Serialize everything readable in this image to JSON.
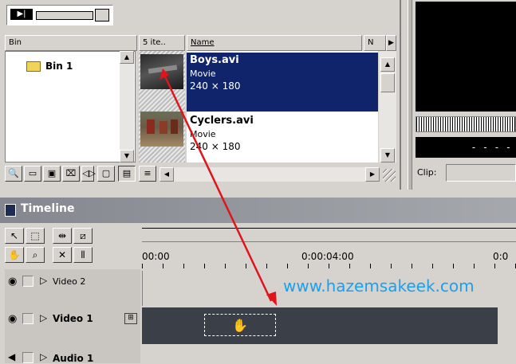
{
  "project": {
    "bin_header": "Bin",
    "count_header": "5 ite..",
    "name_header": "Name",
    "n_header": "N",
    "bin_item": "Bin 1",
    "clips": [
      {
        "name": "Boys.avi",
        "type": "Movie",
        "size": "240 × 180",
        "selected": true
      },
      {
        "name": "Cyclers.avi",
        "type": "Movie",
        "size": "240 × 180",
        "selected": false
      }
    ]
  },
  "monitor": {
    "timecode": "- - - -",
    "clip_label": "Clip:"
  },
  "timeline": {
    "title": "Timeline",
    "ruler": [
      "00:00",
      "0:00:04:00",
      "0:0"
    ],
    "tracks": [
      {
        "label": "Video 2"
      },
      {
        "label": "Video 1"
      },
      {
        "label": "Audio 1"
      }
    ]
  },
  "watermark": "www.hazemsakeek.com",
  "colors": {
    "selection": "#10246b",
    "panel": "#d6d3ce",
    "watermark": "#1aa0f0",
    "arrow": "#e0141a",
    "track_fill": "#3b4048"
  }
}
